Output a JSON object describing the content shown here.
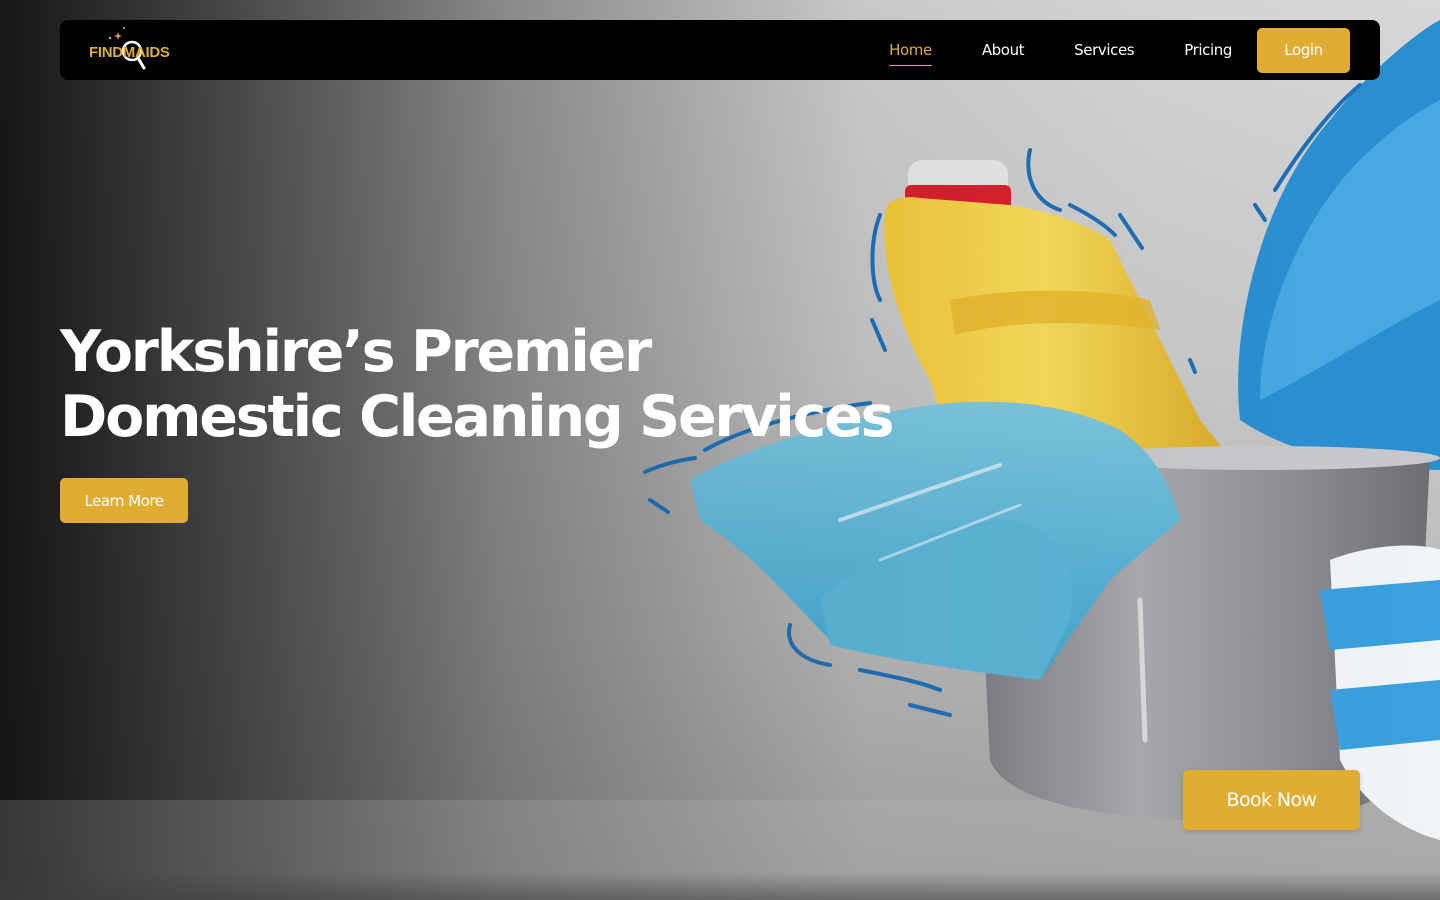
{
  "brand": {
    "logo_text": "FINDMAIDS",
    "accent_color": "#e0ad32"
  },
  "nav": {
    "links": [
      {
        "label": "Home",
        "active": true
      },
      {
        "label": "About",
        "active": false
      },
      {
        "label": "Services",
        "active": false
      },
      {
        "label": "Pricing",
        "active": false
      }
    ],
    "login_label": "Login"
  },
  "hero": {
    "headline_line1": "Yorkshire’s Premier",
    "headline_line2": "Domestic Cleaning Services",
    "learn_more_label": "Learn More",
    "book_now_label": "Book Now",
    "image_subject": "cleaning-supplies-bucket"
  }
}
